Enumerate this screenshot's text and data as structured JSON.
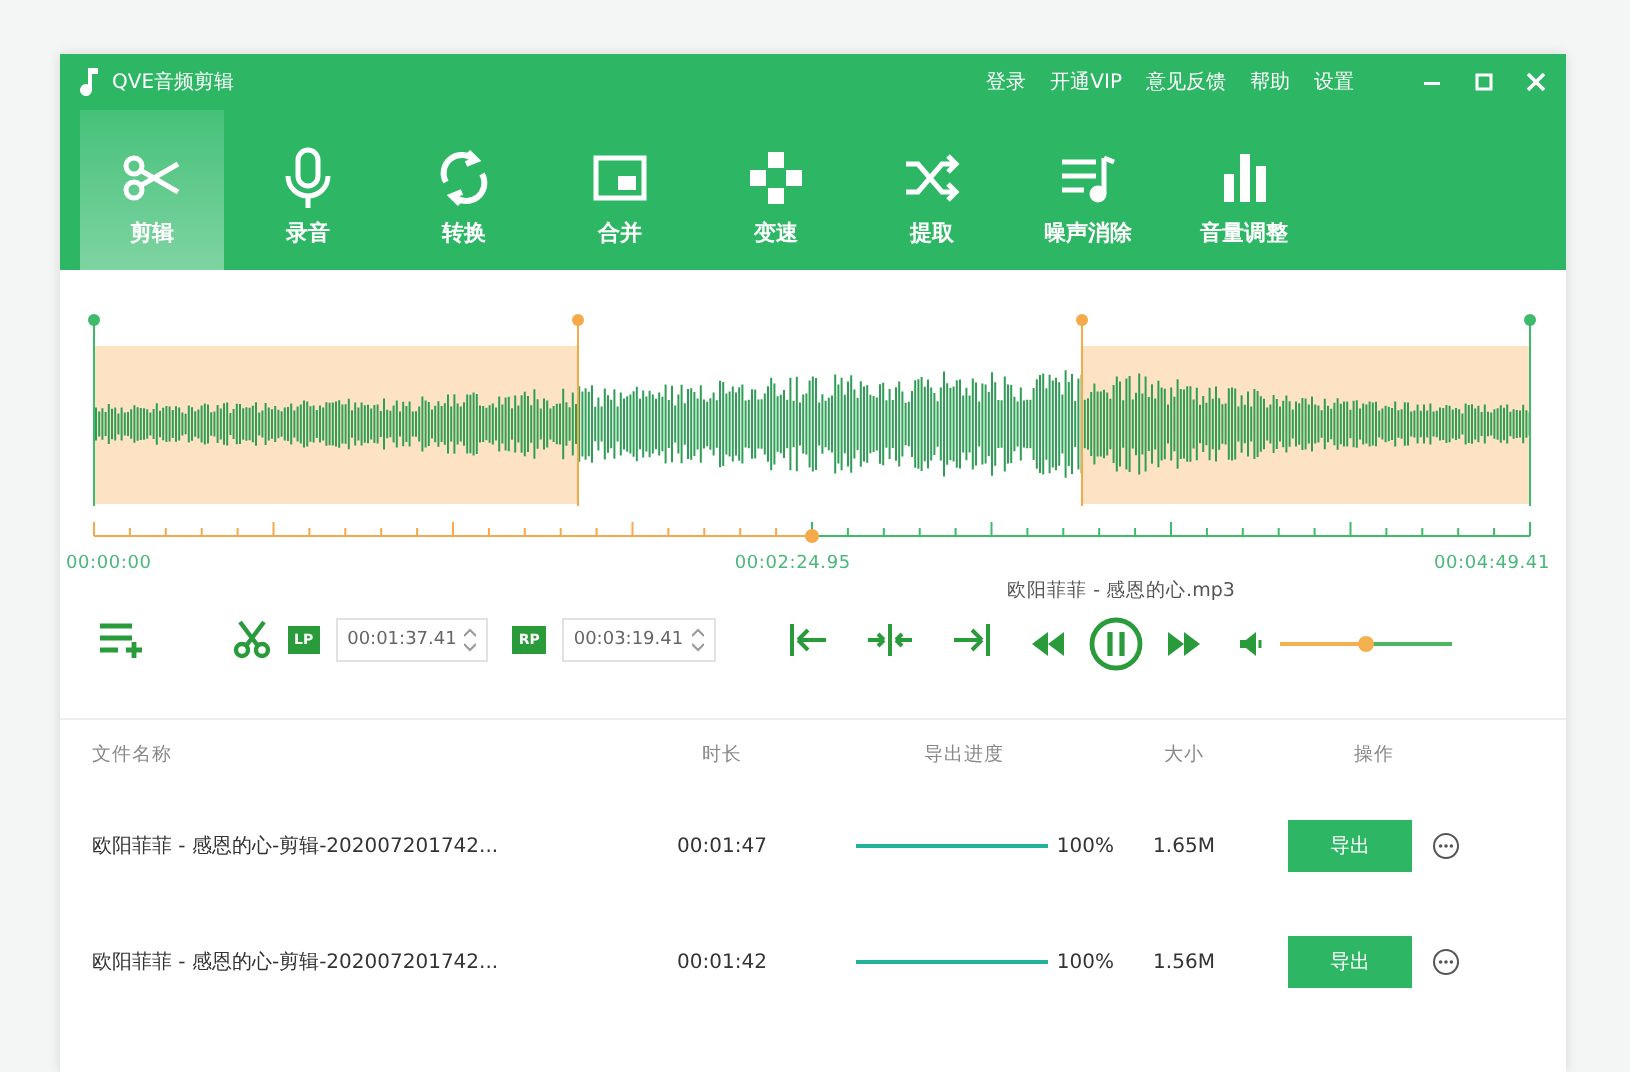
{
  "window": {
    "title": "QVE音频剪辑",
    "menu": [
      "登录",
      "开通VIP",
      "意见反馈",
      "帮助",
      "设置"
    ]
  },
  "tools": [
    {
      "label": "剪辑",
      "selected": true
    },
    {
      "label": "录音",
      "selected": false
    },
    {
      "label": "转换",
      "selected": false
    },
    {
      "label": "合并",
      "selected": false
    },
    {
      "label": "变速",
      "selected": false
    },
    {
      "label": "提取",
      "selected": false
    },
    {
      "label": "噪声消除",
      "selected": false
    },
    {
      "label": "音量调整",
      "selected": false
    }
  ],
  "timeline": {
    "start": "00:00:00",
    "current": "00:02:24.95",
    "end": "00:04:49.41",
    "playhead": {
      "level": 0.5
    }
  },
  "player": {
    "file": "欧阳菲菲 - 感恩的心.mp3",
    "lp_label": "LP",
    "lp_time": "00:01:37.41",
    "rp_label": "RP",
    "rp_time": "00:03:19.41",
    "playing": true,
    "volume": {
      "level": 0.5
    }
  },
  "table": {
    "columns": [
      "文件名称",
      "时长",
      "导出进度",
      "大小",
      "操作"
    ],
    "rows": [
      {
        "name": "欧阳菲菲 - 感恩的心-剪辑-202007201742...",
        "duration": "00:01:47",
        "progress": {
          "level": 1
        },
        "percent": "100%",
        "size": "1.65M",
        "action": "导出"
      },
      {
        "name": "欧阳菲菲 - 感恩的心-剪辑-202007201742...",
        "duration": "00:01:42",
        "progress": {
          "level": 1
        },
        "percent": "100%",
        "size": "1.56M",
        "action": "导出"
      }
    ]
  }
}
